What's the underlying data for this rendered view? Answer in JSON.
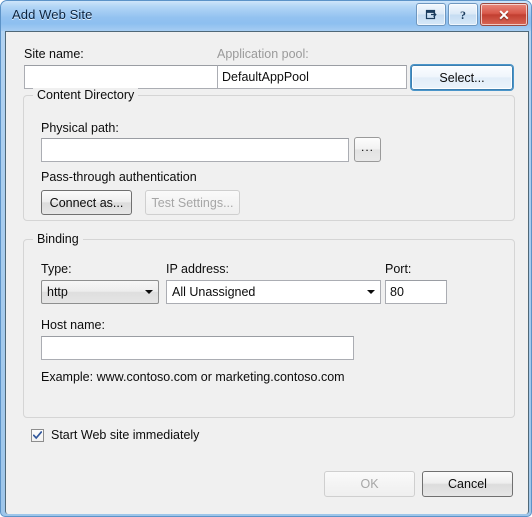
{
  "window": {
    "title": "Add Web Site",
    "caption_buttons": [
      {
        "name": "restore-icon",
        "glyph": ""
      },
      {
        "name": "help-icon",
        "glyph": "?"
      },
      {
        "name": "close-icon",
        "glyph": "✕"
      }
    ]
  },
  "site": {
    "name_label": "Site name:",
    "name_value": "",
    "name_placeholder": "",
    "app_pool_label": "Application pool:",
    "app_pool_value": "DefaultAppPool",
    "select_button": "Select..."
  },
  "content_directory": {
    "group_title": "Content Directory",
    "physical_path_label": "Physical path:",
    "physical_path_value": "",
    "physical_path_placeholder": "",
    "browse_button": "...",
    "auth_text": "Pass-through authentication",
    "connect_as_button": "Connect as...",
    "test_settings_button": "Test Settings..."
  },
  "binding": {
    "group_title": "Binding",
    "type_label": "Type:",
    "type_value": "http",
    "ip_label": "IP address:",
    "ip_value": "All Unassigned",
    "port_label": "Port:",
    "port_value": "80",
    "host_label": "Host name:",
    "host_value": "",
    "host_placeholder": "",
    "example_text": "Example: www.contoso.com or marketing.contoso.com"
  },
  "footer": {
    "start_checkbox_label": "Start Web site immediately",
    "start_checkbox_checked": true,
    "ok_button": "OK",
    "cancel_button": "Cancel"
  },
  "colors": {
    "titlebar_accent": "#8dbff0",
    "frame_border": "#5c93c8",
    "close_button": "#c23f31",
    "focus_ring": "#4a95c9",
    "dialog_bg": "#f0f0f0"
  }
}
